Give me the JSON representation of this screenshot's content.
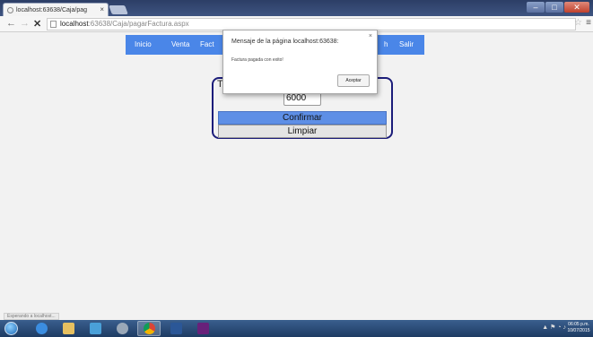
{
  "browser": {
    "tab_title": "localhost:63638/Caja/pag",
    "tab_close": "×",
    "url_host": "localhost",
    "url_path": ":63638/Caja/pagarFactura.aspx",
    "status": "Esperando a localhost..."
  },
  "site_nav": {
    "items": [
      "Inicio",
      "Venta",
      "Fact",
      "h",
      "Salir"
    ]
  },
  "form": {
    "label": "To",
    "amount_value": "6000",
    "confirm_label": "Confirmar",
    "clear_label": "Limpiar"
  },
  "dialog": {
    "title": "Mensaje de la página localhost:63638:",
    "message": "Factura pagada con exito!",
    "ok_label": "Aceptar",
    "close_glyph": "×"
  },
  "taskbar": {
    "apps": [
      "internet-explorer",
      "file-explorer",
      "media-player",
      "app-icon",
      "chrome",
      "word",
      "visual-studio"
    ],
    "time": "06:05 p.m.",
    "date": "10/07/2015"
  },
  "colors": {
    "nav_bg": "#4a86e8",
    "card_border": "#1c1d7a",
    "confirm_bg": "#5e8fe6"
  }
}
